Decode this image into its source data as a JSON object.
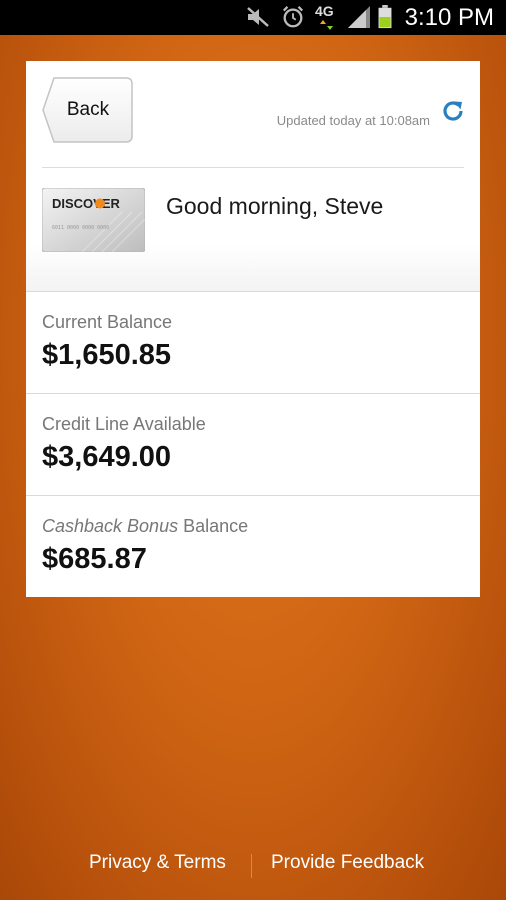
{
  "status_bar": {
    "network": "4G",
    "time": "3:10 PM",
    "icons": [
      "mute-icon",
      "alarm-icon",
      "network-4g-icon",
      "signal-icon",
      "battery-icon"
    ]
  },
  "header": {
    "back_label": "Back",
    "updated_text": "Updated today at 10:08am",
    "refresh_icon": "refresh-icon"
  },
  "account": {
    "card_brand": "DISCOVER",
    "card_number": "6011 0000 0000 0000",
    "greeting": "Good morning, Steve"
  },
  "balances": [
    {
      "label": "Current Balance",
      "value": "$1,650.85"
    },
    {
      "label": "Credit Line Available",
      "value": "$3,649.00"
    },
    {
      "label_italic": "Cashback Bonus",
      "label_rest": " Balance",
      "value": "$685.87"
    }
  ],
  "footer": {
    "privacy_label": "Privacy & Terms",
    "feedback_label": "Provide Feedback"
  },
  "colors": {
    "background": "#d06614",
    "accent_blue": "#2a7fc0",
    "discover_orange": "#f08a1c",
    "battery_green": "#9bd11c"
  }
}
